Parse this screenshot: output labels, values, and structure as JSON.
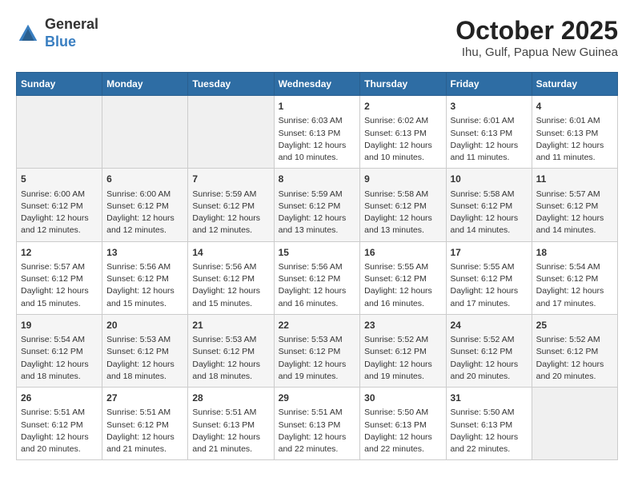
{
  "header": {
    "logo_line1": "General",
    "logo_line2": "Blue",
    "title": "October 2025",
    "subtitle": "Ihu, Gulf, Papua New Guinea"
  },
  "days_of_week": [
    "Sunday",
    "Monday",
    "Tuesday",
    "Wednesday",
    "Thursday",
    "Friday",
    "Saturday"
  ],
  "weeks": [
    [
      {
        "day": "",
        "sunrise": "",
        "sunset": "",
        "daylight": ""
      },
      {
        "day": "",
        "sunrise": "",
        "sunset": "",
        "daylight": ""
      },
      {
        "day": "",
        "sunrise": "",
        "sunset": "",
        "daylight": ""
      },
      {
        "day": "1",
        "sunrise": "Sunrise: 6:03 AM",
        "sunset": "Sunset: 6:13 PM",
        "daylight": "Daylight: 12 hours and 10 minutes."
      },
      {
        "day": "2",
        "sunrise": "Sunrise: 6:02 AM",
        "sunset": "Sunset: 6:13 PM",
        "daylight": "Daylight: 12 hours and 10 minutes."
      },
      {
        "day": "3",
        "sunrise": "Sunrise: 6:01 AM",
        "sunset": "Sunset: 6:13 PM",
        "daylight": "Daylight: 12 hours and 11 minutes."
      },
      {
        "day": "4",
        "sunrise": "Sunrise: 6:01 AM",
        "sunset": "Sunset: 6:13 PM",
        "daylight": "Daylight: 12 hours and 11 minutes."
      }
    ],
    [
      {
        "day": "5",
        "sunrise": "Sunrise: 6:00 AM",
        "sunset": "Sunset: 6:12 PM",
        "daylight": "Daylight: 12 hours and 12 minutes."
      },
      {
        "day": "6",
        "sunrise": "Sunrise: 6:00 AM",
        "sunset": "Sunset: 6:12 PM",
        "daylight": "Daylight: 12 hours and 12 minutes."
      },
      {
        "day": "7",
        "sunrise": "Sunrise: 5:59 AM",
        "sunset": "Sunset: 6:12 PM",
        "daylight": "Daylight: 12 hours and 12 minutes."
      },
      {
        "day": "8",
        "sunrise": "Sunrise: 5:59 AM",
        "sunset": "Sunset: 6:12 PM",
        "daylight": "Daylight: 12 hours and 13 minutes."
      },
      {
        "day": "9",
        "sunrise": "Sunrise: 5:58 AM",
        "sunset": "Sunset: 6:12 PM",
        "daylight": "Daylight: 12 hours and 13 minutes."
      },
      {
        "day": "10",
        "sunrise": "Sunrise: 5:58 AM",
        "sunset": "Sunset: 6:12 PM",
        "daylight": "Daylight: 12 hours and 14 minutes."
      },
      {
        "day": "11",
        "sunrise": "Sunrise: 5:57 AM",
        "sunset": "Sunset: 6:12 PM",
        "daylight": "Daylight: 12 hours and 14 minutes."
      }
    ],
    [
      {
        "day": "12",
        "sunrise": "Sunrise: 5:57 AM",
        "sunset": "Sunset: 6:12 PM",
        "daylight": "Daylight: 12 hours and 15 minutes."
      },
      {
        "day": "13",
        "sunrise": "Sunrise: 5:56 AM",
        "sunset": "Sunset: 6:12 PM",
        "daylight": "Daylight: 12 hours and 15 minutes."
      },
      {
        "day": "14",
        "sunrise": "Sunrise: 5:56 AM",
        "sunset": "Sunset: 6:12 PM",
        "daylight": "Daylight: 12 hours and 15 minutes."
      },
      {
        "day": "15",
        "sunrise": "Sunrise: 5:56 AM",
        "sunset": "Sunset: 6:12 PM",
        "daylight": "Daylight: 12 hours and 16 minutes."
      },
      {
        "day": "16",
        "sunrise": "Sunrise: 5:55 AM",
        "sunset": "Sunset: 6:12 PM",
        "daylight": "Daylight: 12 hours and 16 minutes."
      },
      {
        "day": "17",
        "sunrise": "Sunrise: 5:55 AM",
        "sunset": "Sunset: 6:12 PM",
        "daylight": "Daylight: 12 hours and 17 minutes."
      },
      {
        "day": "18",
        "sunrise": "Sunrise: 5:54 AM",
        "sunset": "Sunset: 6:12 PM",
        "daylight": "Daylight: 12 hours and 17 minutes."
      }
    ],
    [
      {
        "day": "19",
        "sunrise": "Sunrise: 5:54 AM",
        "sunset": "Sunset: 6:12 PM",
        "daylight": "Daylight: 12 hours and 18 minutes."
      },
      {
        "day": "20",
        "sunrise": "Sunrise: 5:53 AM",
        "sunset": "Sunset: 6:12 PM",
        "daylight": "Daylight: 12 hours and 18 minutes."
      },
      {
        "day": "21",
        "sunrise": "Sunrise: 5:53 AM",
        "sunset": "Sunset: 6:12 PM",
        "daylight": "Daylight: 12 hours and 18 minutes."
      },
      {
        "day": "22",
        "sunrise": "Sunrise: 5:53 AM",
        "sunset": "Sunset: 6:12 PM",
        "daylight": "Daylight: 12 hours and 19 minutes."
      },
      {
        "day": "23",
        "sunrise": "Sunrise: 5:52 AM",
        "sunset": "Sunset: 6:12 PM",
        "daylight": "Daylight: 12 hours and 19 minutes."
      },
      {
        "day": "24",
        "sunrise": "Sunrise: 5:52 AM",
        "sunset": "Sunset: 6:12 PM",
        "daylight": "Daylight: 12 hours and 20 minutes."
      },
      {
        "day": "25",
        "sunrise": "Sunrise: 5:52 AM",
        "sunset": "Sunset: 6:12 PM",
        "daylight": "Daylight: 12 hours and 20 minutes."
      }
    ],
    [
      {
        "day": "26",
        "sunrise": "Sunrise: 5:51 AM",
        "sunset": "Sunset: 6:12 PM",
        "daylight": "Daylight: 12 hours and 20 minutes."
      },
      {
        "day": "27",
        "sunrise": "Sunrise: 5:51 AM",
        "sunset": "Sunset: 6:12 PM",
        "daylight": "Daylight: 12 hours and 21 minutes."
      },
      {
        "day": "28",
        "sunrise": "Sunrise: 5:51 AM",
        "sunset": "Sunset: 6:13 PM",
        "daylight": "Daylight: 12 hours and 21 minutes."
      },
      {
        "day": "29",
        "sunrise": "Sunrise: 5:51 AM",
        "sunset": "Sunset: 6:13 PM",
        "daylight": "Daylight: 12 hours and 22 minutes."
      },
      {
        "day": "30",
        "sunrise": "Sunrise: 5:50 AM",
        "sunset": "Sunset: 6:13 PM",
        "daylight": "Daylight: 12 hours and 22 minutes."
      },
      {
        "day": "31",
        "sunrise": "Sunrise: 5:50 AM",
        "sunset": "Sunset: 6:13 PM",
        "daylight": "Daylight: 12 hours and 22 minutes."
      },
      {
        "day": "",
        "sunrise": "",
        "sunset": "",
        "daylight": ""
      }
    ]
  ]
}
